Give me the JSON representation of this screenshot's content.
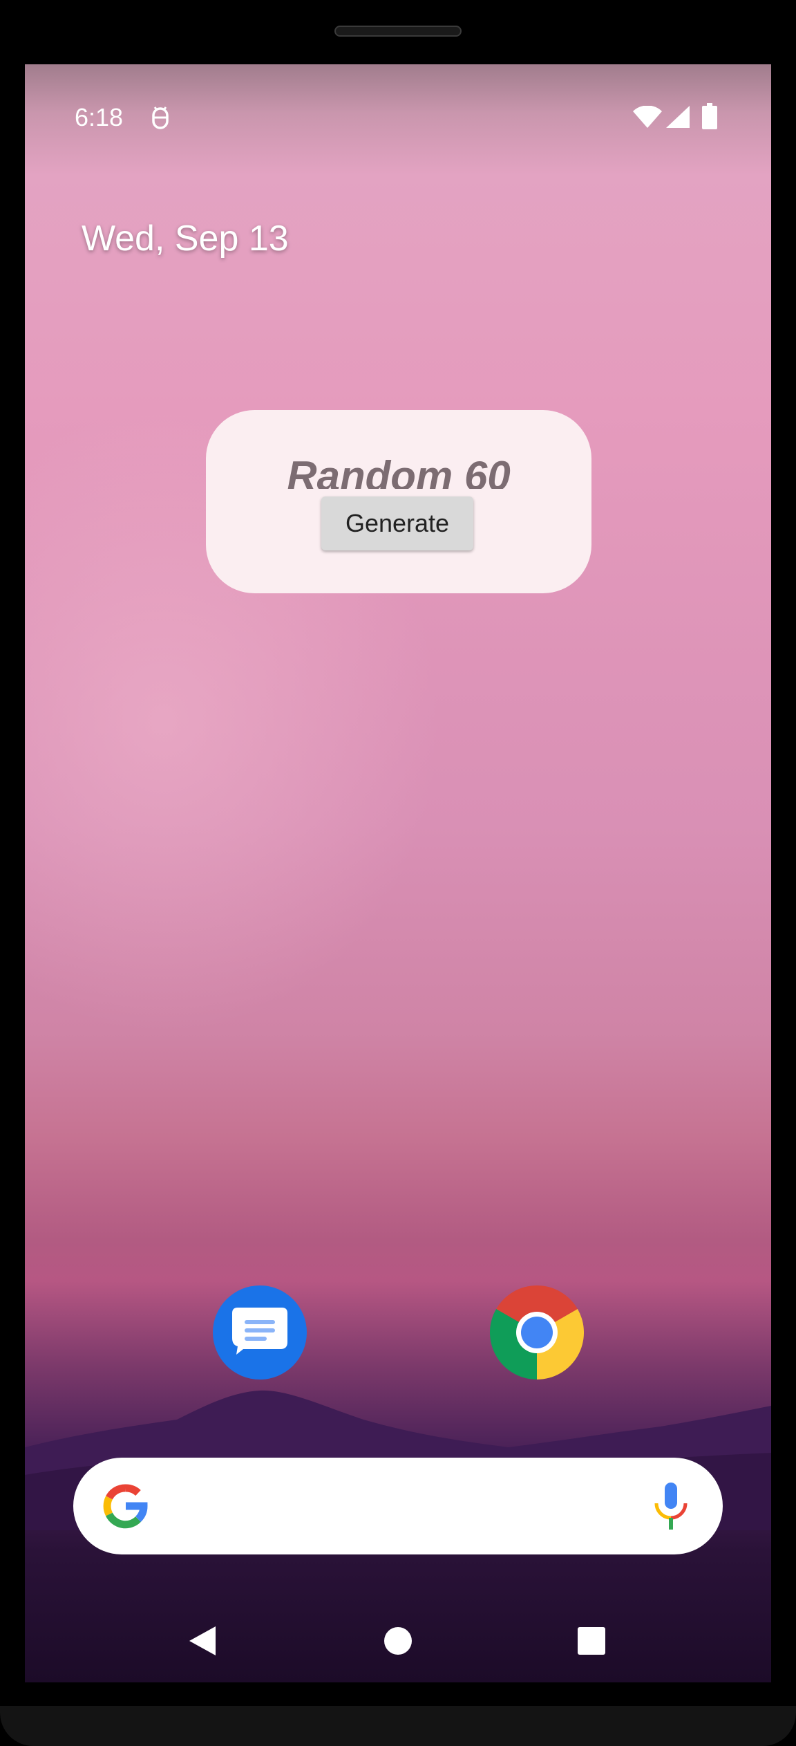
{
  "status_bar": {
    "time": "6:18",
    "icons": [
      "android-debug-icon",
      "wifi-icon",
      "cellular-signal-icon",
      "battery-icon"
    ]
  },
  "home": {
    "date": "Wed, Sep 13"
  },
  "widget": {
    "title": "Random 60",
    "button_label": "Generate"
  },
  "dock": {
    "apps": [
      {
        "name": "Messages",
        "icon": "messages-icon",
        "color": "#1a73e8"
      },
      {
        "name": "Chrome",
        "icon": "chrome-icon"
      }
    ]
  },
  "search_bar": {
    "left_icon": "google-g-icon",
    "right_icon": "microphone-icon"
  },
  "nav_bar": {
    "buttons": [
      "back-icon",
      "home-icon",
      "recents-icon"
    ]
  }
}
